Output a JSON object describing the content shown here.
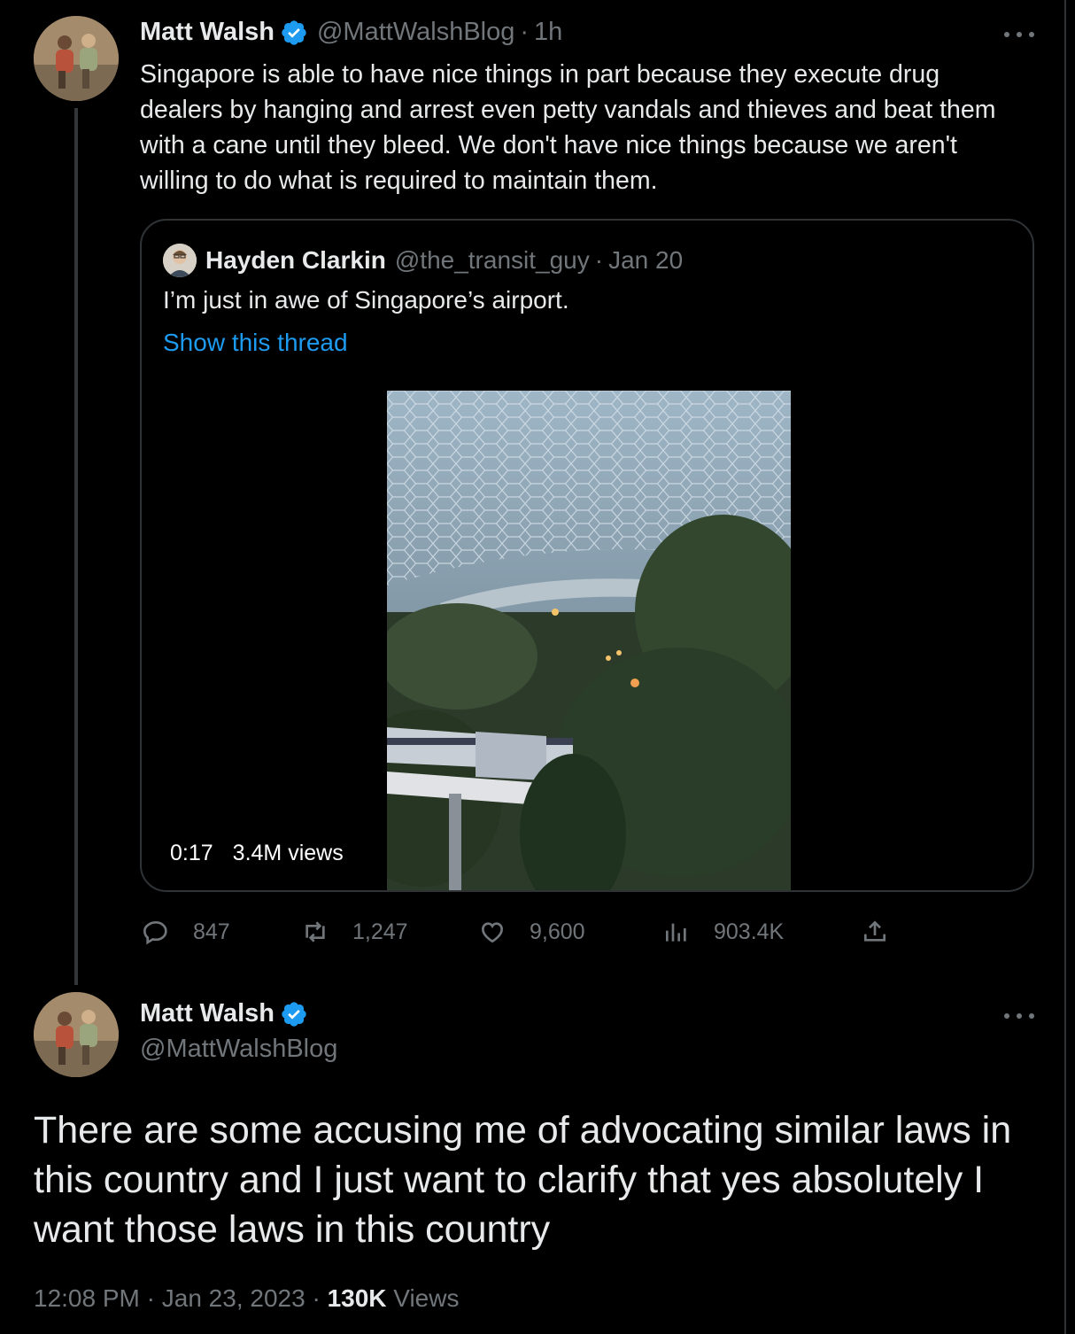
{
  "tweet": {
    "author_name": "Matt Walsh",
    "author_handle": "@MattWalshBlog",
    "separator": "·",
    "time": "1h",
    "text": "Singapore is able to have nice things in part because they execute drug dealers by hanging and arrest even petty vandals and thieves and beat them with a cane until they bleed. We don't have nice things because we aren't willing to do what is required to maintain them.",
    "quoted": {
      "author_name": "Hayden Clarkin",
      "author_handle": "@the_transit_guy",
      "separator": "·",
      "date": "Jan 20",
      "text": "I’m just in awe of Singapore’s airport.",
      "thread_link": "Show this thread",
      "video_duration": "0:17",
      "video_views": "3.4M views"
    },
    "stats": {
      "replies": "847",
      "retweets": "1,247",
      "likes": "9,600",
      "views": "903.4K"
    }
  },
  "reply": {
    "author_name": "Matt Walsh",
    "author_handle": "@MattWalshBlog",
    "text": "There are some accusing me of advocating similar laws in this country and I just want to clarify that yes absolutely I want those laws in this country",
    "time": "12:08 PM",
    "separator": "·",
    "date": "Jan 23, 2023",
    "views_count": "130K",
    "views_label": "Views"
  },
  "colors": {
    "background": "#000000",
    "text": "#e7e9ea",
    "muted": "#71767b",
    "link": "#1d9bf0",
    "border": "#2f3336"
  }
}
